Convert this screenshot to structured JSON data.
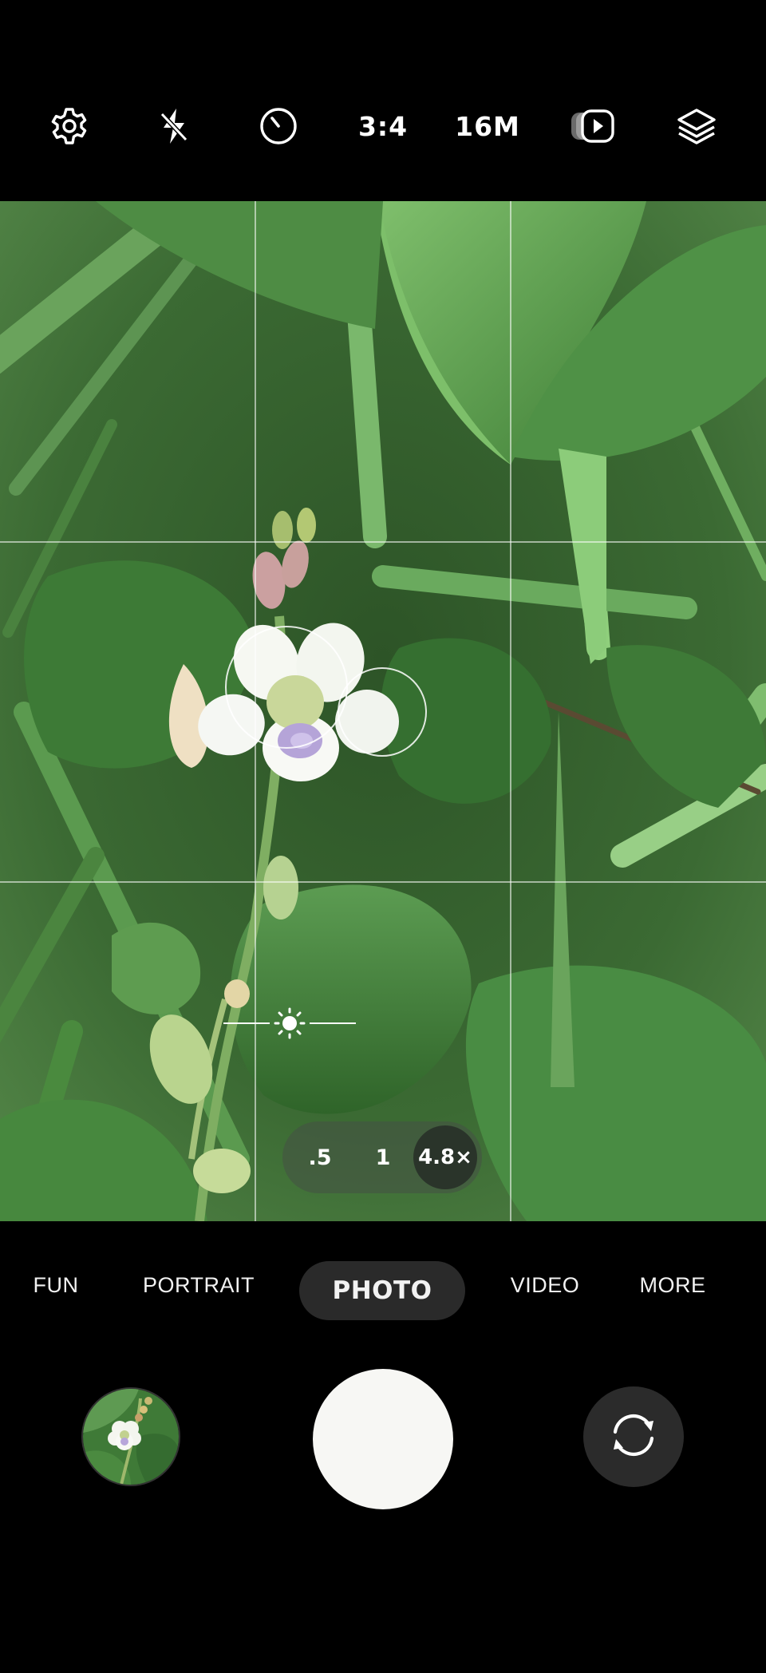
{
  "top_bar": {
    "items": [
      {
        "name": "settings-icon"
      },
      {
        "name": "flash-off-icon"
      },
      {
        "name": "timer-icon"
      },
      {
        "name": "aspect-ratio",
        "label": "3:4"
      },
      {
        "name": "resolution",
        "label": "16M"
      },
      {
        "name": "motion-photo-icon"
      },
      {
        "name": "filters-icon"
      }
    ]
  },
  "zoom": {
    "options": [
      ".5",
      "1",
      "4.8×"
    ],
    "selected": "4.8×"
  },
  "modes": {
    "items": [
      "FUN",
      "PORTRAIT",
      "PHOTO",
      "VIDEO",
      "MORE"
    ],
    "active": "PHOTO"
  },
  "capture": {
    "thumbnail": "gallery-thumbnail",
    "shutter": "shutter-button",
    "switch": "switch-camera-icon"
  },
  "colors": {
    "background": "#000000",
    "active_pill": "#2a2a2a",
    "shutter": "#f7f7f4",
    "foliage": "#3e7a36"
  }
}
